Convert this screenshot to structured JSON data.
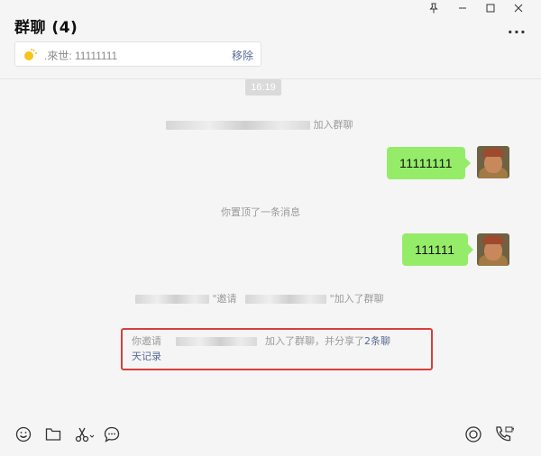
{
  "window": {
    "title": "群聊 (4)",
    "controls": {
      "pin": "pin-icon",
      "minimize": "minimize-icon",
      "maximize": "maximize-icon",
      "close": "close-icon",
      "more": "···"
    }
  },
  "pinned": {
    "icon": "sun-icon",
    "text": ".來世: 11111111",
    "remove_label": "移除"
  },
  "messages": {
    "time": "16:19",
    "join_notice": "加入群聊",
    "bubble1": "11111111",
    "pin_notice": "你置顶了一条消息",
    "bubble2": "111111",
    "invite_prefix": "\"邀请",
    "invite_suffix": "\"加入了群聊",
    "share_prefix": "你邀请",
    "share_middle": "加入了群聊，并分享了",
    "share_link": "2条聊",
    "share_link_line2": "天记录"
  },
  "toolbar": {
    "left_icons": [
      "emoji-icon",
      "folder-icon",
      "scissors-icon",
      "chat-icon"
    ],
    "right_icons": [
      "live-icon",
      "call-icon"
    ]
  },
  "colors": {
    "bubble": "#95ec69",
    "link": "#576b95",
    "highlight": "#d6403a"
  }
}
